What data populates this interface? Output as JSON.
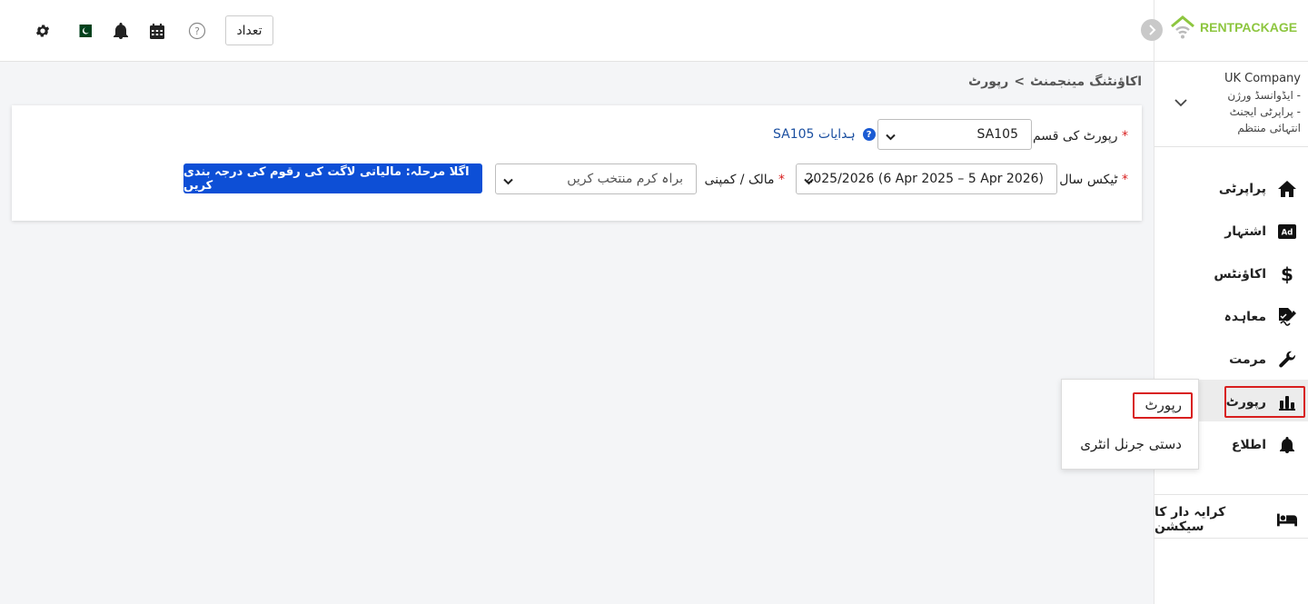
{
  "header": {
    "count_label": "تعداد",
    "icons": [
      "gear-icon",
      "pakistan-flag-icon",
      "bell-icon",
      "calendar-icon",
      "help-circle-icon"
    ]
  },
  "brand": {
    "name_part1": "RENT",
    "name_part2": "PACKAGE",
    "accent": "#8dc63f"
  },
  "company": {
    "name": "UK Company",
    "line1": "ایڈوانسڈ ورژن -",
    "line2": "پراپرٹی ایجنٹ -",
    "line3": "انتہائی منتظم"
  },
  "sidebar": {
    "items": [
      {
        "label": "پراپرٹی",
        "icon": "home-icon"
      },
      {
        "label": "اشتہار",
        "icon": "ad-icon"
      },
      {
        "label": "اکاؤنٹس",
        "icon": "dollar-icon"
      },
      {
        "label": "معاہدہ",
        "icon": "signature-icon"
      },
      {
        "label": "مرمت",
        "icon": "wrench-icon"
      },
      {
        "label": "رپورٹ",
        "icon": "chart-icon"
      },
      {
        "label": "اطلاع",
        "icon": "bell-icon"
      },
      {
        "label": "کرایہ دار کا سیکشن",
        "icon": "bed-icon"
      }
    ]
  },
  "flyout": {
    "items": [
      {
        "label": "رپورٹ"
      },
      {
        "label": "دستی جرنل انٹری"
      }
    ]
  },
  "breadcrumb": {
    "parent": "اکاؤنٹنگ مینجمنٹ",
    "separator": ">",
    "current": "رپورٹ"
  },
  "form": {
    "report_type_label": "رپورٹ کی قسم",
    "report_type_value": "SA105",
    "help_text": "SA105 ہدایات",
    "tax_year_label": "ٹیکس سال",
    "tax_year_value": "2025/2026 (6 Apr 2025 – 5 Apr 2026)",
    "owner_label": "مالک / کمپنی",
    "owner_placeholder": "براہ کرم منتخب کریں",
    "next_button": "اگلا مرحلہ: مالیاتی لاگت کی رقوم کی درجہ بندی کریں",
    "required_mark": "*"
  },
  "colors": {
    "primary": "#0d4fd6",
    "required": "#d81e1e",
    "highlight": "#d81e1e"
  }
}
